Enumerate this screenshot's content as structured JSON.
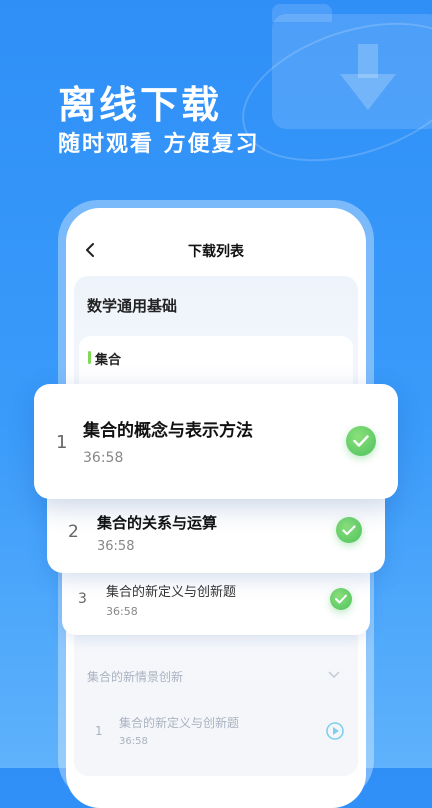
{
  "hero": {
    "title": "离线下载",
    "subtitle": "随时观看  方便复习"
  },
  "nav": {
    "title": "下载列表"
  },
  "course": {
    "title": "数学通用基础",
    "chapter": "集合"
  },
  "lessons": [
    {
      "num": "1",
      "title": "集合的概念与表示方法",
      "duration": "36:58",
      "status": "downloaded"
    },
    {
      "num": "2",
      "title": "集合的关系与运算",
      "duration": "36:58",
      "status": "downloaded"
    },
    {
      "num": "3",
      "title": "集合的新定义与创新题",
      "duration": "36:58",
      "status": "downloaded"
    }
  ],
  "next_chapter": {
    "title": "集合的新情景创新"
  },
  "faded_lesson": {
    "num": "1",
    "title": "集合的新定义与创新题",
    "duration": "36:58"
  },
  "colors": {
    "accent": "#3a9bfa",
    "check": "#4ec25e",
    "chapter_bar": "#7ed957"
  },
  "icons": [
    "back-icon",
    "check-icon",
    "download-folder-icon",
    "chevron-down-icon",
    "play-icon"
  ]
}
